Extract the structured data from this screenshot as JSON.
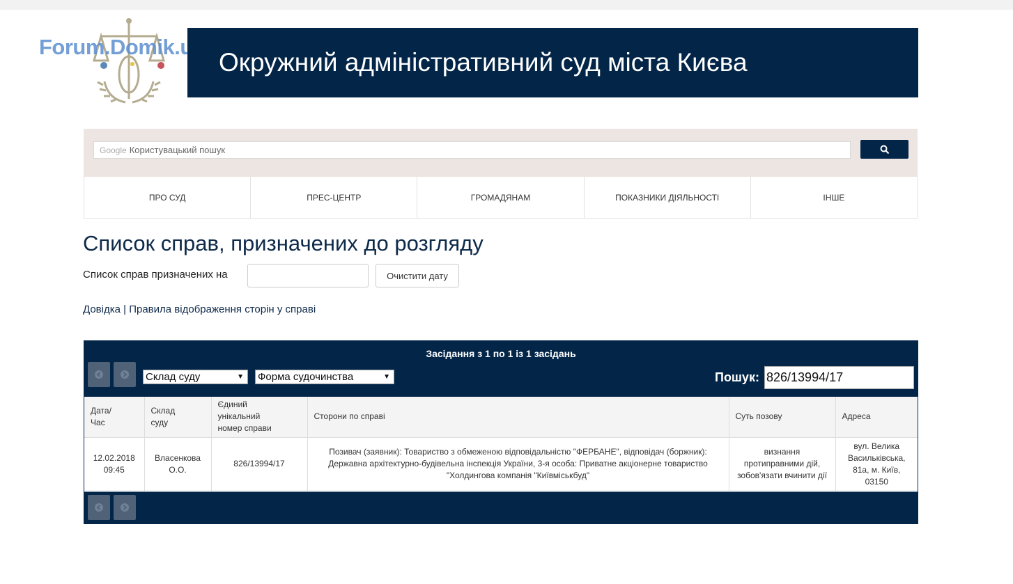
{
  "watermark": "Forum.Domik.ua",
  "court_name": "Окружний адміністративний суд міста Києва",
  "search": {
    "google_label": "Google",
    "placeholder": "Користувацький пошук",
    "button_icon": "search-icon"
  },
  "nav": [
    {
      "label": "ПРО СУД"
    },
    {
      "label": "ПРЕС-ЦЕНТР"
    },
    {
      "label": "ГРОМАДЯНАМ"
    },
    {
      "label": "ПОКАЗНИКИ ДІЯЛЬНОСТІ"
    },
    {
      "label": "ІНШЕ"
    }
  ],
  "page_title": "Список справ, призначених до розгляду",
  "date_filter": {
    "label": "Список справ призначених на",
    "value": "",
    "clear_label": "Очистити дату"
  },
  "links": {
    "help": "Довідка",
    "separator": "|",
    "rules": "Правила відображення сторін у справі"
  },
  "table": {
    "info": "Засідання з 1 по 1 із 1 засідань",
    "filter_court_composition": "Склад суду",
    "filter_proceeding_form": "Форма судочинства",
    "search_label": "Пошук:",
    "search_value": "826/13994/17",
    "columns": {
      "date": [
        "Дата/",
        "Час"
      ],
      "composition": [
        "Склад",
        "суду"
      ],
      "case_number": [
        "Єдиний",
        "унікальний",
        "номер справи"
      ],
      "parties": "Сторони по справі",
      "claim": "Суть позову",
      "address": "Адреса"
    },
    "rows": [
      {
        "date": "12.02.2018",
        "time": "09:45",
        "composition": [
          "Власенкова",
          "О.О."
        ],
        "case_number": "826/13994/17",
        "parties": [
          "Позивач (заявник): Товариство з обмеженою відповідальністю \"ФЕРБАНЕ\", відповідач (боржник):",
          "Державна архітектурно-будівельна інспекція України, 3-я особа: Приватне акціонерне товариство",
          "\"Холдингова компанія \"Київміськбуд\""
        ],
        "claim": [
          "визнання",
          "протиправними дій,",
          "зобов'язати вчинити дії"
        ],
        "address": [
          "вул. Велика",
          "Васильківська,",
          "81а, м. Київ,",
          "03150"
        ]
      }
    ]
  },
  "colors": {
    "brand_navy": "#032548",
    "search_bg": "#ede5e1"
  }
}
